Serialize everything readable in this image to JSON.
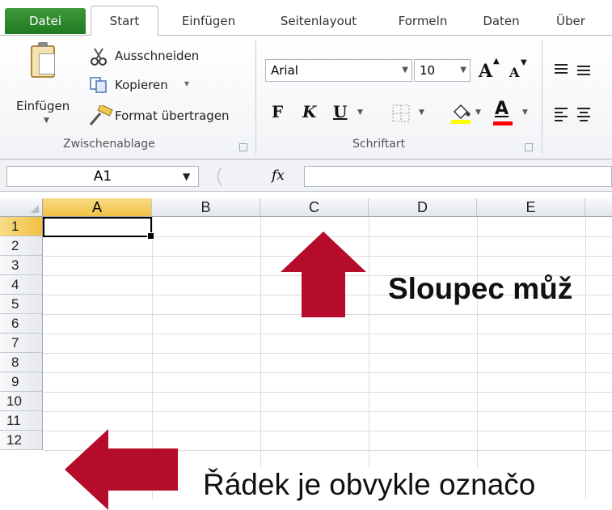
{
  "tabs": [
    {
      "label": "Datei"
    },
    {
      "label": "Start"
    },
    {
      "label": "Einfügen"
    },
    {
      "label": "Seitenlayout"
    },
    {
      "label": "Formeln"
    },
    {
      "label": "Daten"
    },
    {
      "label": "Über"
    }
  ],
  "clipboard": {
    "paste_label": "Einfügen",
    "cut_label": "Ausschneiden",
    "copy_label": "Kopieren",
    "copy_caret": "▾",
    "format_painter_label": "Format übertragen",
    "group_label": "Zwischenablage"
  },
  "font": {
    "name": "Arial",
    "size": "10",
    "group_label": "Schriftart",
    "bold": "F",
    "italic": "K",
    "underline": "U",
    "grow": "A",
    "shrink": "A",
    "font_color_letter": "A",
    "highlight_color": "#ffff00",
    "font_color": "#ff0000"
  },
  "formula_bar": {
    "name_box": "A1",
    "fx_label": "fx",
    "formula_value": ""
  },
  "sheet": {
    "columns": [
      "A",
      "B",
      "C",
      "D",
      "E"
    ],
    "rows": [
      "1",
      "2",
      "3",
      "4",
      "5",
      "6",
      "7",
      "8",
      "9",
      "10",
      "11",
      "12"
    ],
    "active_cell": "A1"
  },
  "annotations": {
    "column_text": "Sloupec můž",
    "row_text": "Řádek je obvykle označo",
    "arrow_color": "#b50c2b"
  }
}
